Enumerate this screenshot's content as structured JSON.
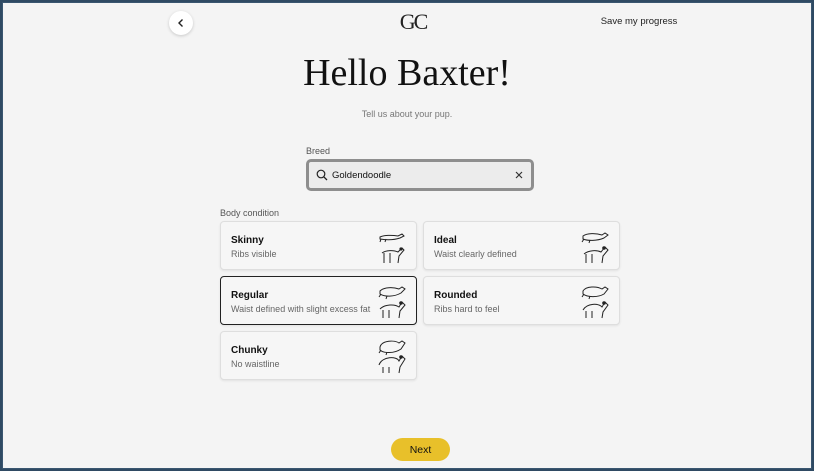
{
  "header": {
    "back_icon": "chevron-left-icon",
    "logo_text": "GC",
    "save_label": "Save my progress"
  },
  "main": {
    "title": "Hello Baxter!",
    "subtitle": "Tell us about your pup."
  },
  "breed": {
    "label": "Breed",
    "value": "Goldendoodle",
    "search_icon": "search-icon",
    "clear_icon": "close-icon"
  },
  "body_condition": {
    "label": "Body condition",
    "selected": "Regular",
    "options": [
      {
        "title": "Skinny",
        "desc": "Ribs visible",
        "icon": "dog-skinny-icon"
      },
      {
        "title": "Ideal",
        "desc": "Waist clearly defined",
        "icon": "dog-ideal-icon"
      },
      {
        "title": "Regular",
        "desc": "Waist defined with slight excess fat",
        "icon": "dog-regular-icon"
      },
      {
        "title": "Rounded",
        "desc": "Ribs hard to feel",
        "icon": "dog-rounded-icon"
      },
      {
        "title": "Chunky",
        "desc": "No waistline",
        "icon": "dog-chunky-icon"
      }
    ]
  },
  "footer": {
    "next_label": "Next",
    "accent_color": "#e8c02a"
  }
}
